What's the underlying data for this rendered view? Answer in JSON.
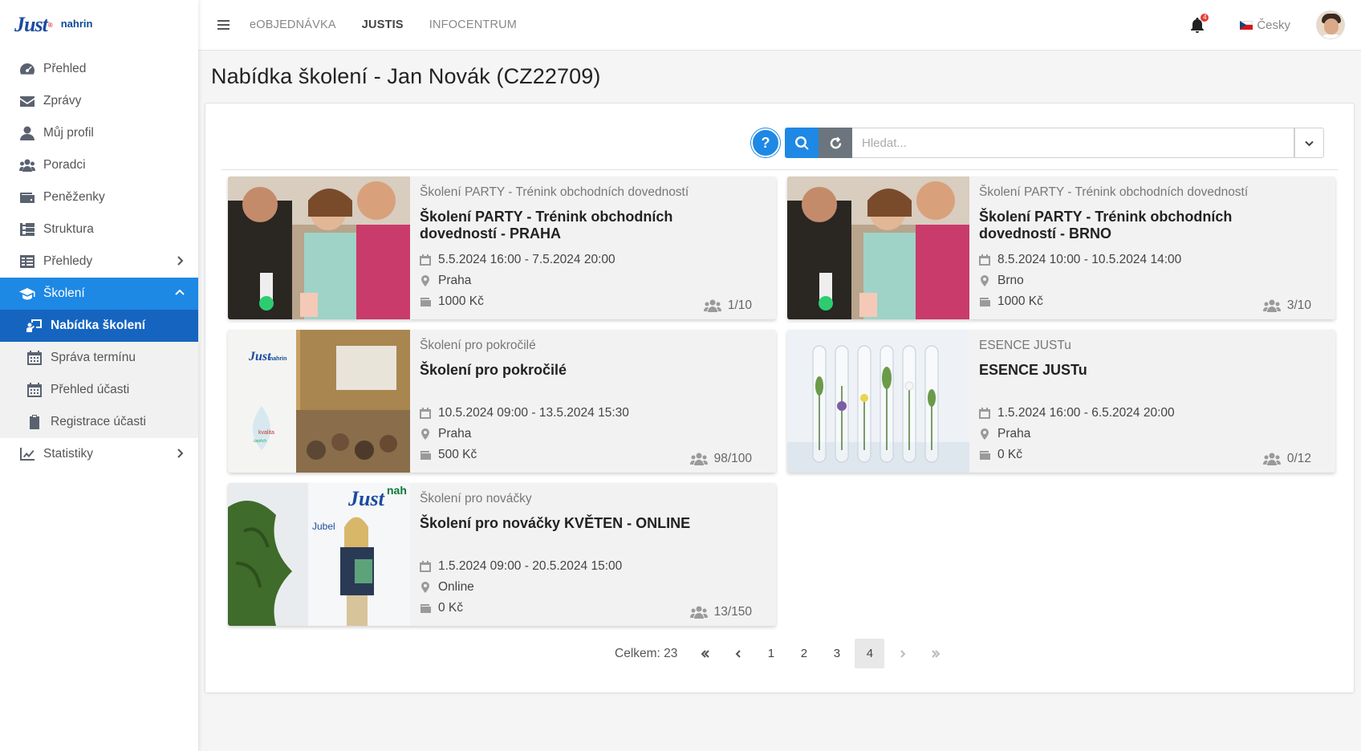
{
  "brand": {
    "logo_text": "Just",
    "logo_partner": "nahrin"
  },
  "sidebar": {
    "items": [
      {
        "label": "Přehled"
      },
      {
        "label": "Zprávy"
      },
      {
        "label": "Můj profil"
      },
      {
        "label": "Poradci"
      },
      {
        "label": "Peněženky"
      },
      {
        "label": "Struktura"
      },
      {
        "label": "Přehledy"
      },
      {
        "label": "Školení"
      },
      {
        "label": "Statistiky"
      }
    ],
    "sub_items": [
      {
        "label": "Nabídka školení"
      },
      {
        "label": "Správa termínu"
      },
      {
        "label": "Přehled účasti"
      },
      {
        "label": "Registrace účasti"
      }
    ]
  },
  "topbar": {
    "nav": [
      "eOBJEDNÁVKA",
      "JUSTIS",
      "INFOCENTRUM"
    ],
    "notification_count": "4",
    "language": "Česky"
  },
  "page": {
    "title": "Nabídka školení - Jan Novák (CZ22709)"
  },
  "search": {
    "help_label": "?",
    "placeholder": "Hledat..."
  },
  "cards": [
    {
      "category": "Školení PARTY - Trénink obchodních dovedností",
      "title": "Školení PARTY - Trénink obchodních dovedností - PRAHA",
      "date": "5.5.2024 16:00 - 7.5.2024 20:00",
      "location": "Praha",
      "price": "1000 Kč",
      "capacity": "1/10"
    },
    {
      "category": "Školení PARTY - Trénink obchodních dovedností",
      "title": "Školení PARTY - Trénink obchodních dovedností - BRNO",
      "date": "8.5.2024 10:00 - 10.5.2024 14:00",
      "location": "Brno",
      "price": "1000 Kč",
      "capacity": "3/10"
    },
    {
      "category": "Školení pro pokročilé",
      "title": "Školení pro pokročilé",
      "date": "10.5.2024 09:00 - 13.5.2024 15:30",
      "location": "Praha",
      "price": "500 Kč",
      "capacity": "98/100"
    },
    {
      "category": "ESENCE JUSTu",
      "title": "ESENCE JUSTu",
      "date": "1.5.2024 16:00 - 6.5.2024 20:00",
      "location": "Praha",
      "price": "0 Kč",
      "capacity": "0/12"
    },
    {
      "category": "Školení pro nováčky",
      "title": "Školení pro nováčky KVĚTEN - ONLINE",
      "date": "1.5.2024 09:00 - 20.5.2024 15:00",
      "location": "Online",
      "price": "0 Kč",
      "capacity": "13/150"
    }
  ],
  "pagination": {
    "total_label": "Celkem: 23",
    "pages": [
      "1",
      "2",
      "3",
      "4"
    ],
    "current": "4"
  },
  "colors": {
    "primary": "#1e88e5",
    "primary_dark": "#1565c0",
    "secondary": "#6c757d"
  }
}
